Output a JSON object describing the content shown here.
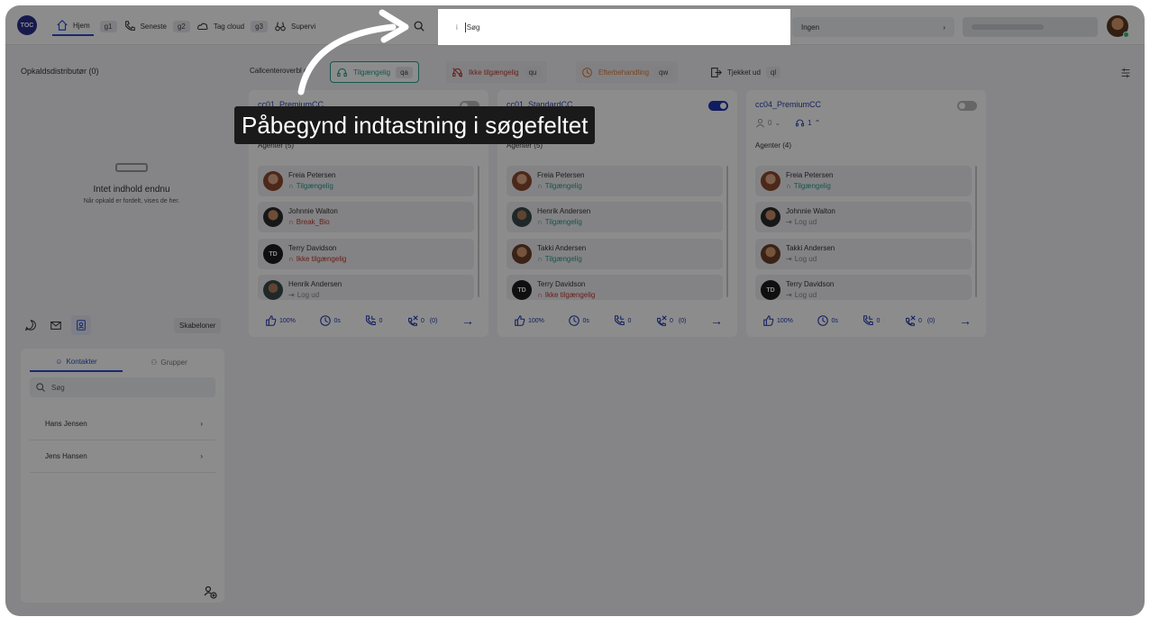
{
  "topbar": {
    "logo": "TOC",
    "nav": [
      {
        "label": "Hjem",
        "key": "g1",
        "icon": "home-icon"
      },
      {
        "label": "Seneste",
        "key": "g2",
        "icon": "phone-icon"
      },
      {
        "label": "Tag cloud",
        "key": "g3",
        "icon": "cloud-icon"
      },
      {
        "label": "Supervi",
        "key": "",
        "icon": "binoculars-icon"
      }
    ],
    "search_prefix": "i",
    "search_placeholder": "Søg",
    "queue_select": "Ingen"
  },
  "left": {
    "title": "Opkaldsdistributør (0)",
    "empty_title": "Intet indhold endnu",
    "empty_text": "Når opkald er fordelt, vises de her.",
    "templates_button": "Skabeloner",
    "tabs": [
      "Kontakter",
      "Grupper"
    ],
    "search_placeholder": "Søg",
    "contacts": [
      "Hans Jensen",
      "Jens Hansen"
    ]
  },
  "toolbar": {
    "label": "Callcenteroverbl gt",
    "statuses": [
      {
        "label": "Tilgængelig",
        "key": "qa",
        "color": "#2a9d8f"
      },
      {
        "label": "Ikke tilgængelig",
        "key": "qu",
        "color": "#c0392b"
      },
      {
        "label": "Efterbehandling",
        "key": "qw",
        "color": "#e07b39"
      },
      {
        "label": "Tjekket ud",
        "key": "ql",
        "color": "#333333"
      }
    ]
  },
  "cards": [
    {
      "name": "cc01_PremiumCC",
      "toggle_on": false,
      "waiting": "",
      "active": "",
      "agents_label": "Agenter (5)",
      "agents": [
        {
          "name": "Freia Petersen",
          "status": "Tilgængelig",
          "kind": "green",
          "avatar": "photo1"
        },
        {
          "name": "Johnnie Walton",
          "status": "Break_Bio",
          "kind": "red",
          "avatar": "photo2"
        },
        {
          "name": "Terry Davidson",
          "status": "Ikke tilgængelig",
          "kind": "red",
          "avatar": "initials",
          "initials": "TD"
        },
        {
          "name": "Henrik Andersen",
          "status": "Log ud",
          "kind": "gray",
          "avatar": "photo3"
        }
      ],
      "metrics": {
        "sla": "100%",
        "wait": "0s",
        "calls": "0",
        "missed": "0",
        "missed_sub": "(0)"
      }
    },
    {
      "name": "cc01_StandardCC",
      "toggle_on": true,
      "waiting": "",
      "active": "",
      "agents_label": "Agenter (5)",
      "agents": [
        {
          "name": "Freia Petersen",
          "status": "Tilgængelig",
          "kind": "green",
          "avatar": "photo1"
        },
        {
          "name": "Henrik Andersen",
          "status": "Tilgængelig",
          "kind": "green",
          "avatar": "photo3"
        },
        {
          "name": "Takki Andersen",
          "status": "Tilgængelig",
          "kind": "green",
          "avatar": "photo4"
        },
        {
          "name": "Terry Davidson",
          "status": "Ikke tilgængelig",
          "kind": "red",
          "avatar": "initials",
          "initials": "TD"
        }
      ],
      "metrics": {
        "sla": "100%",
        "wait": "0s",
        "calls": "0",
        "missed": "0",
        "missed_sub": "(0)"
      }
    },
    {
      "name": "cc04_PremiumCC",
      "toggle_on": false,
      "waiting": "0",
      "active": "1",
      "agents_label": "Agenter (4)",
      "agents": [
        {
          "name": "Freia Petersen",
          "status": "Tilgængelig",
          "kind": "green",
          "avatar": "photo1"
        },
        {
          "name": "Johnnie Walton",
          "status": "Log ud",
          "kind": "gray",
          "avatar": "photo2"
        },
        {
          "name": "Takki Andersen",
          "status": "Log ud",
          "kind": "gray",
          "avatar": "photo4"
        },
        {
          "name": "Terry Davidson",
          "status": "Log ud",
          "kind": "gray",
          "avatar": "initials",
          "initials": "TD"
        }
      ],
      "metrics": {
        "sla": "100%",
        "wait": "0s",
        "calls": "0",
        "missed": "0",
        "missed_sub": "(0)"
      }
    }
  ],
  "tooltip": "Påbegynd indtastning i søgefeltet"
}
